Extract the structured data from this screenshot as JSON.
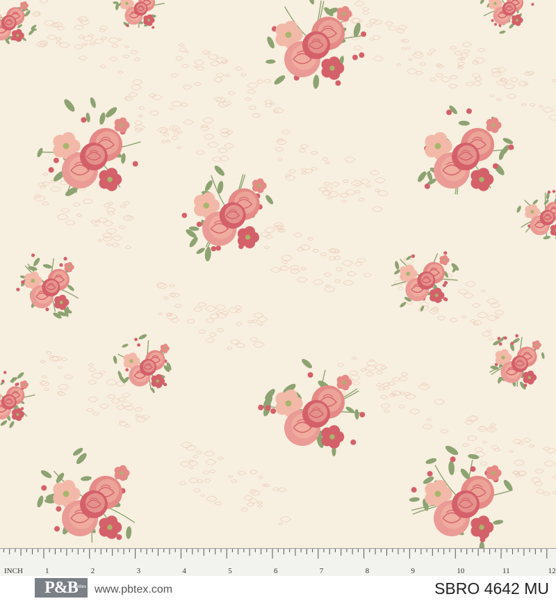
{
  "ruler": {
    "unit_label": "INCH",
    "numbers": [
      "1",
      "2",
      "3",
      "4",
      "5",
      "6",
      "7",
      "8",
      "9",
      "10",
      "11",
      "12"
    ]
  },
  "footer": {
    "logo_text": "P&B",
    "logo_sub": "textiles",
    "website": "www.pbtex.com",
    "sku": "SBRO 4642 MU"
  },
  "colors": {
    "background": "#f7efdf",
    "rose_deep": "#d4606a",
    "rose_mid": "#e58a86",
    "rose_light": "#f3b9a8",
    "leaf": "#8da372",
    "lace": "#e7b2a0"
  }
}
